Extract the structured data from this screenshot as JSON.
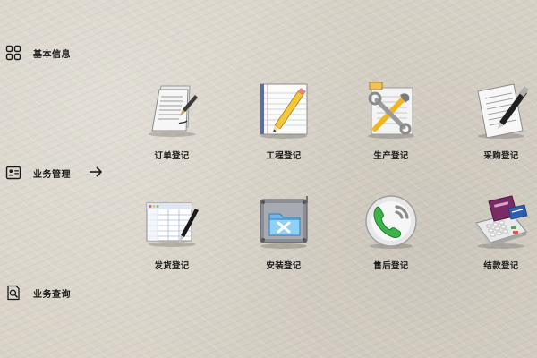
{
  "sidebar": {
    "items": [
      {
        "label": "基本信息",
        "icon": "grid-icon"
      },
      {
        "label": "业务管理",
        "icon": "id-card-icon"
      },
      {
        "label": "业务查询",
        "icon": "document-search-icon"
      }
    ],
    "active_indicator": "arrow-right-icon"
  },
  "tiles": [
    {
      "label": "订单登记",
      "icon": "document-pen-icon"
    },
    {
      "label": "工程登记",
      "icon": "notebook-pencil-icon"
    },
    {
      "label": "生产登记",
      "icon": "tools-document-icon"
    },
    {
      "label": "采购登记",
      "icon": "paper-pen-icon"
    },
    {
      "label": "发货登记",
      "icon": "spreadsheet-pen-icon"
    },
    {
      "label": "安装登记",
      "icon": "folder-tools-icon"
    },
    {
      "label": "售后登记",
      "icon": "phone-icon"
    },
    {
      "label": "结款登记",
      "icon": "card-payment-icon"
    }
  ]
}
